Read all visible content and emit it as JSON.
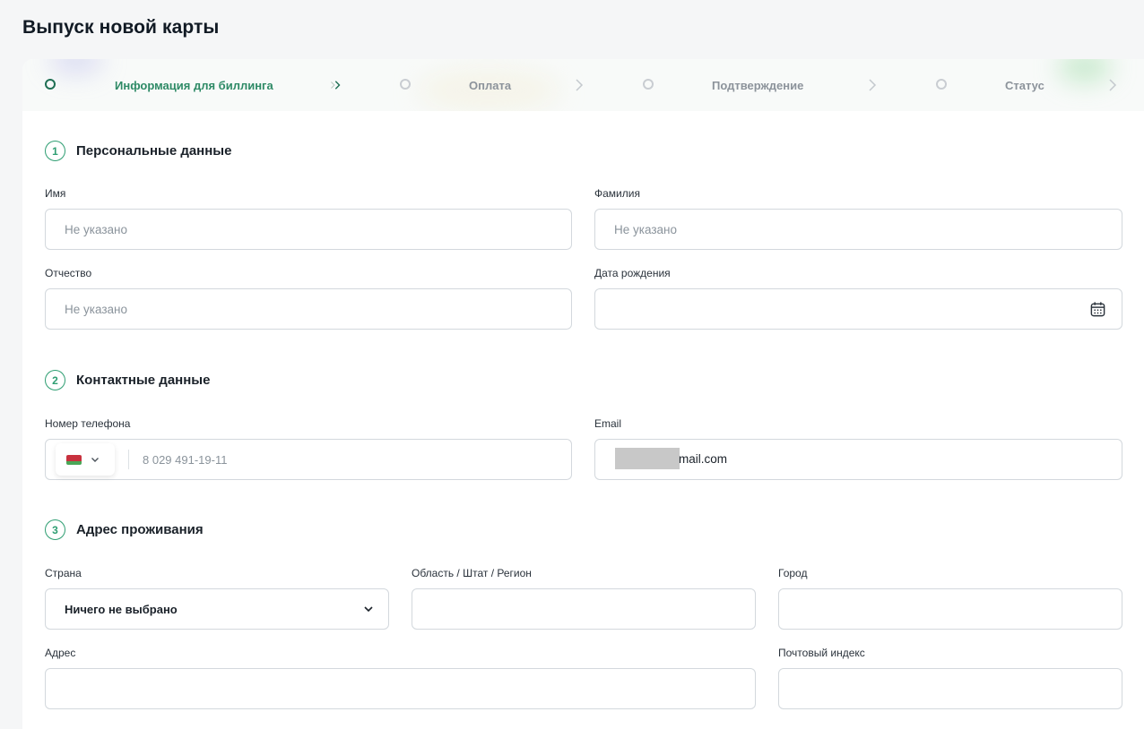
{
  "page": {
    "title": "Выпуск новой карты"
  },
  "stepper": {
    "steps": [
      {
        "label": "Информация для биллинга",
        "active": true
      },
      {
        "label": "Оплата",
        "active": false
      },
      {
        "label": "Подтверждение",
        "active": false
      },
      {
        "label": "Статус",
        "active": false
      }
    ]
  },
  "sections": {
    "personal": {
      "number": "1",
      "title": "Персональные данные",
      "first_name": {
        "label": "Имя",
        "placeholder": "Не указано"
      },
      "last_name": {
        "label": "Фамилия",
        "placeholder": "Не указано"
      },
      "middle_name": {
        "label": "Отчество",
        "placeholder": "Не указано"
      },
      "birth_date": {
        "label": "Дата рождения",
        "value": ""
      }
    },
    "contacts": {
      "number": "2",
      "title": "Контактные данные",
      "phone": {
        "label": "Номер телефона",
        "placeholder": "8 029 491-19-11",
        "country_flag": "belarus-flag-icon"
      },
      "email": {
        "label": "Email",
        "value": "mail.com"
      }
    },
    "address": {
      "number": "3",
      "title": "Адрес проживания",
      "country": {
        "label": "Страна",
        "value": "Ничего не выбрано"
      },
      "region": {
        "label": "Область / Штат / Регион",
        "value": ""
      },
      "city": {
        "label": "Город",
        "value": ""
      },
      "street": {
        "label": "Адрес",
        "value": ""
      },
      "postal": {
        "label": "Почтовый индекс",
        "value": ""
      }
    }
  },
  "colors": {
    "accent": "#2e9e72",
    "active_step": "#2e8a66",
    "border": "#d3d8dd"
  }
}
